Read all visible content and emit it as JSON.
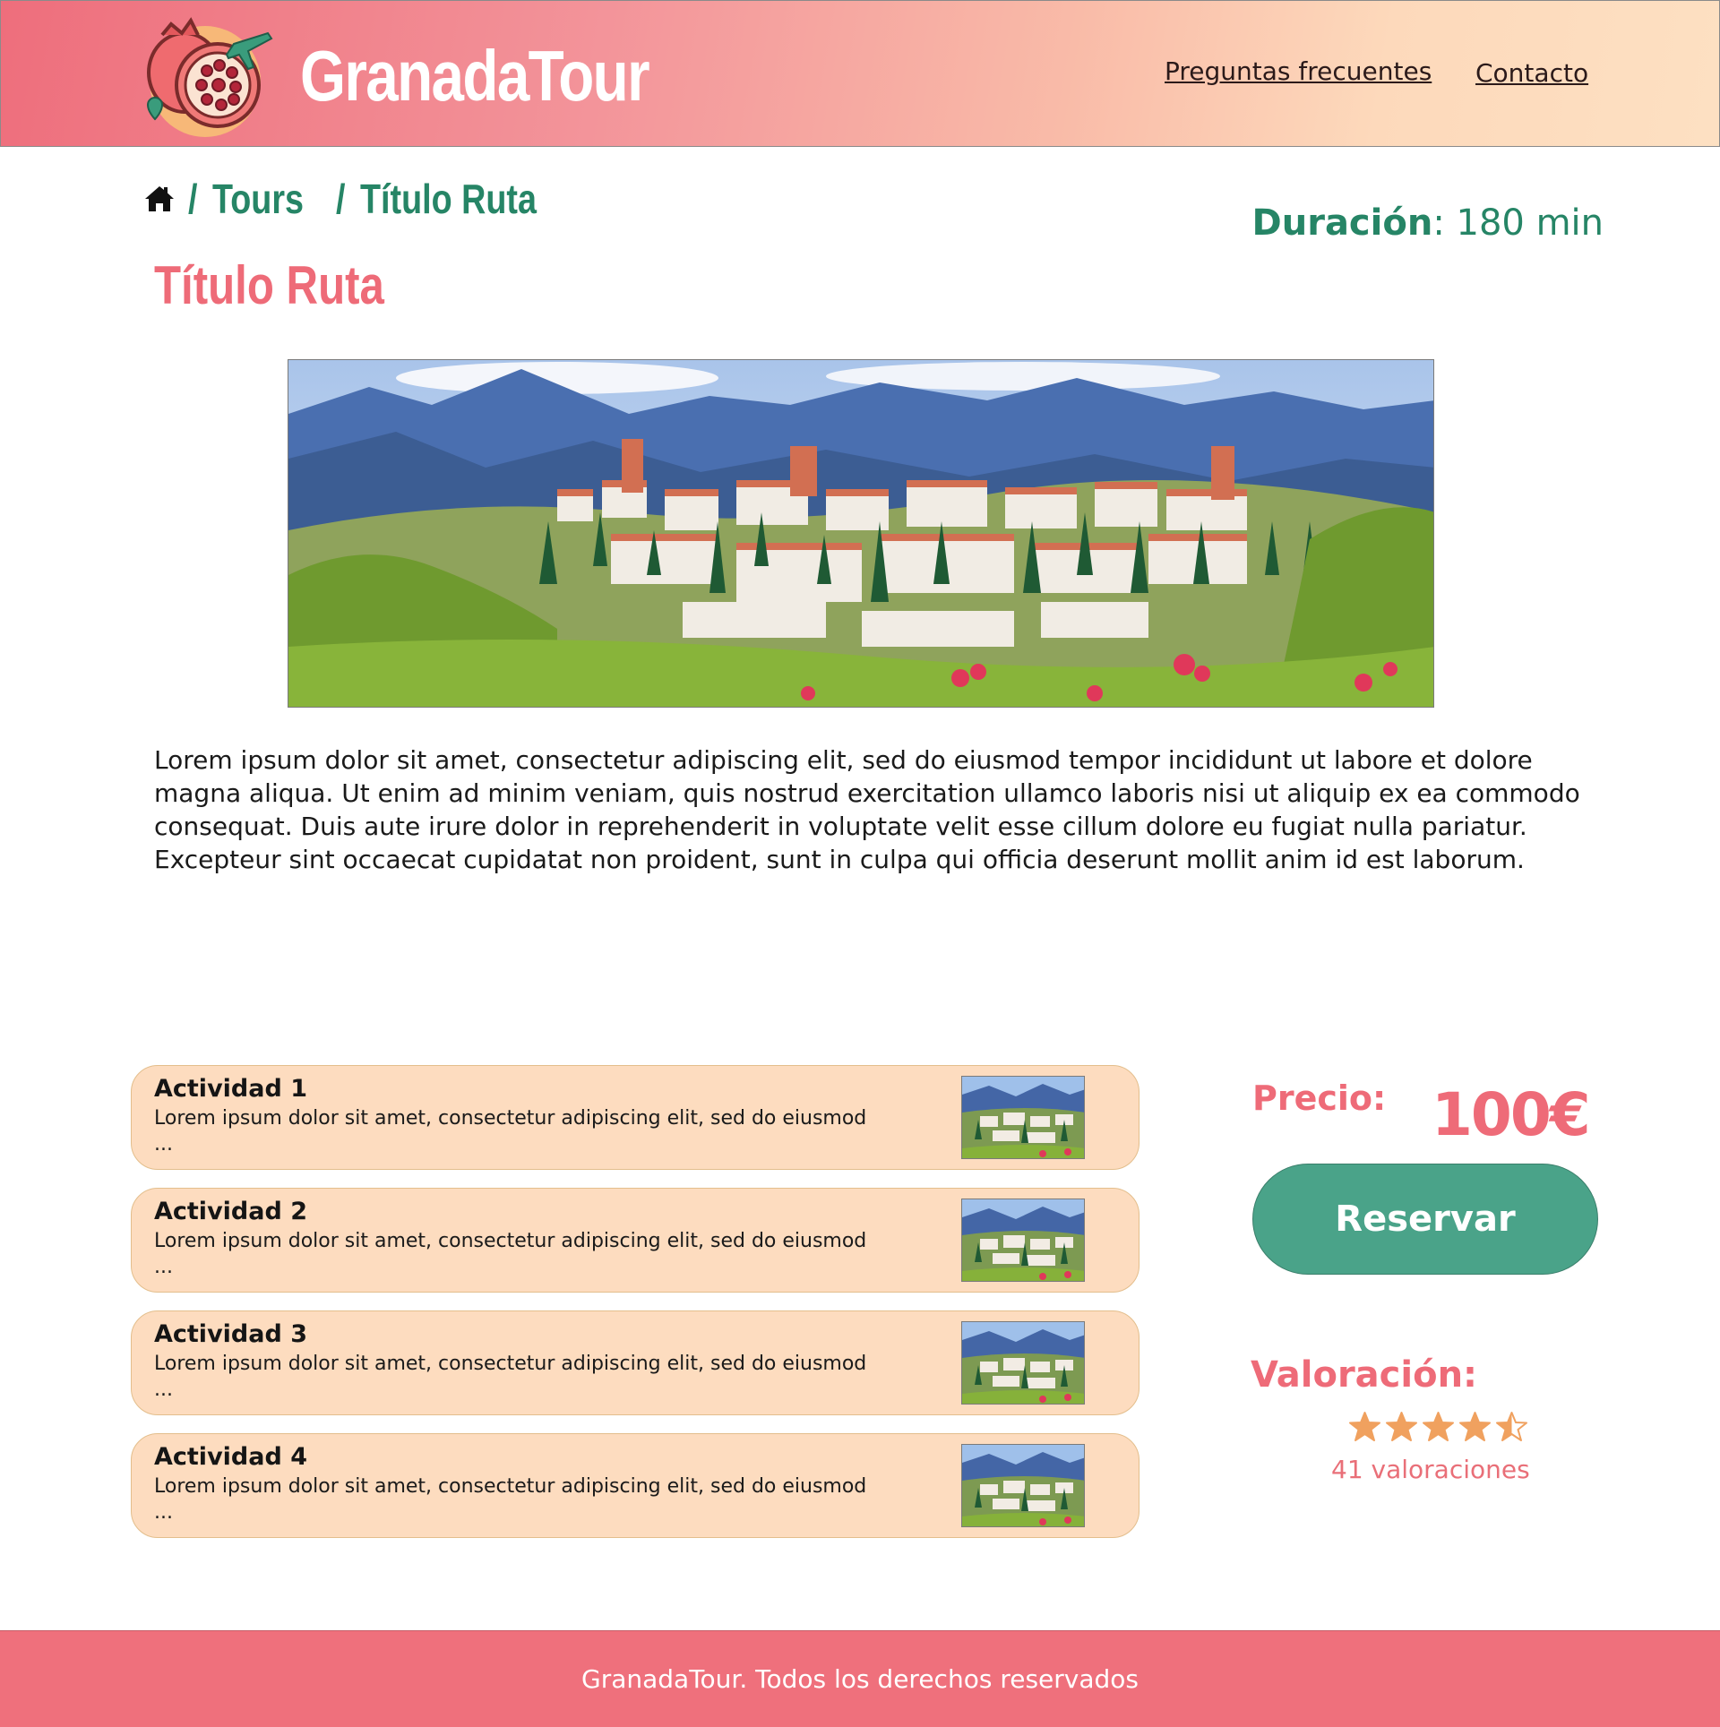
{
  "header": {
    "brand": "GranadaTour",
    "nav": {
      "faq": "Preguntas frecuentes",
      "contact": "Contacto"
    }
  },
  "breadcrumb": {
    "separator": "/",
    "tours": "Tours",
    "current": "Título Ruta"
  },
  "tour": {
    "title": "Título Ruta",
    "duration_label": "Duración",
    "duration_value": ": 180 min",
    "description": "Lorem ipsum dolor sit amet, consectetur adipiscing elit, sed do eiusmod tempor incididunt ut labore et dolore magna aliqua. Ut enim ad minim veniam, quis nostrud exercitation ullamco laboris nisi ut aliquip ex ea commodo consequat. Duis aute irure dolor in reprehenderit in voluptate velit esse cillum dolore eu fugiat nulla pariatur. Excepteur sint occaecat cupidatat non proident, sunt in culpa qui officia deserunt mollit anim id est laborum."
  },
  "activities": [
    {
      "title": "Actividad 1",
      "text": "Lorem ipsum dolor sit amet, consectetur adipiscing elit, sed do eiusmod ..."
    },
    {
      "title": "Actividad 2",
      "text": "Lorem ipsum dolor sit amet, consectetur adipiscing elit, sed do eiusmod ..."
    },
    {
      "title": "Actividad 3",
      "text": "Lorem ipsum dolor sit amet, consectetur adipiscing elit, sed do eiusmod ..."
    },
    {
      "title": "Actividad 4",
      "text": "Lorem ipsum dolor sit amet, consectetur adipiscing elit, sed do eiusmod ..."
    }
  ],
  "pricing": {
    "label": "Precio:",
    "value": "100€",
    "button": "Reservar"
  },
  "rating": {
    "label": "Valoración:",
    "stars": 4.5,
    "max_stars": 5,
    "count_text": "41 valoraciones"
  },
  "footer": {
    "text": "GranadaTour. Todos los derechos reservados"
  },
  "colors": {
    "brand_pink": "#ee6b78",
    "brand_green": "#268566",
    "button_green": "#4aa389",
    "card_peach": "#fddcbf",
    "star_orange": "#f0a15f"
  },
  "icons": {
    "logo": "pomegranate-airplane-logo",
    "home": "home-icon",
    "star": "star-icon"
  }
}
